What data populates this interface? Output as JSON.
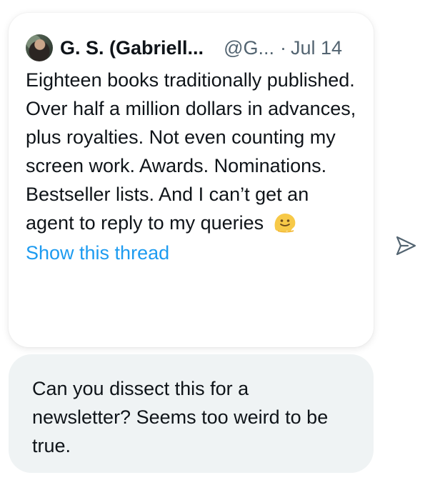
{
  "tweet": {
    "author_name": "G. S. (Gabriell...",
    "author_handle": "@G...",
    "separator": "·",
    "date": "Jul 14",
    "body_text": "Eighteen books traditionally published. Over half a million dollars in advances, plus royalties. Not even counting my screen work. Awards. Nominations. Bestseller lists. And I can’t get an agent to reply to my queries",
    "emoji_icon": "melting-face-icon",
    "show_thread_label": "Show this thread"
  },
  "share": {
    "icon": "send-icon"
  },
  "message": {
    "text": "Can you dissect this for a newsletter? Seems too weird to be true."
  },
  "colors": {
    "text_primary": "#0f1419",
    "text_secondary": "#536471",
    "link": "#1d9bf0",
    "bubble_bg": "#eff3f4",
    "emoji_yellow": "#f7c948"
  }
}
